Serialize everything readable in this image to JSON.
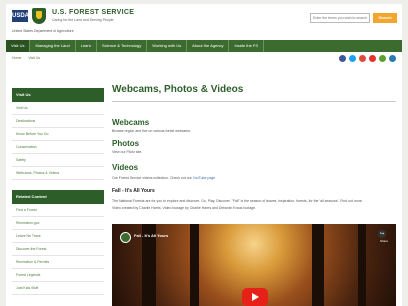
{
  "header": {
    "usda_badge": "USDA",
    "agency": "U.S. FOREST SERVICE",
    "tagline": "Caring for the Land and Serving People",
    "department": "United States Department of Agriculture",
    "search_placeholder": "Enter the terms you wish to search for.",
    "search_button": "Search"
  },
  "nav": {
    "items": [
      "Visit Us",
      "Managing the Land",
      "Learn",
      "Science & Technology",
      "Working with Us",
      "About the Agency",
      "Inside the FS"
    ]
  },
  "breadcrumb": [
    "Home",
    "Visit Us"
  ],
  "social": {
    "colors": [
      "#3b5998",
      "#1da1f2",
      "#dd4b39",
      "#e5312d",
      "#5aa02c",
      "#2a7ab0"
    ]
  },
  "sidebar": {
    "visit_heading": "Visit Us",
    "visit_items": [
      "Visit Us",
      "Destinations",
      "Know Before You Go",
      "Conservation",
      "Safety",
      "Webcams, Photos & Videos"
    ],
    "related_heading": "Related Content",
    "related_items": [
      "Find a Forest",
      "Recreation.gov",
      "Leave No Trace",
      "Discover the Forest",
      "Recreation & Permits",
      "Forest Legends",
      "Just Kids Stuff"
    ]
  },
  "main": {
    "title": "Webcams, Photos & Videos",
    "webcams_heading": "Webcams",
    "webcams_text": "Browse region and live on various forest webcams.",
    "photos_heading": "Photos",
    "photos_text": "View our Flickr site.",
    "videos_heading": "Videos",
    "videos_text_prefix": "Our Forest Service videos collection. Check out our",
    "videos_link": "YouTube page",
    "section_title": "Fall - It's All Yours",
    "section_desc_1": "The National Forests are for you to explore and discover. Go, Play, Discover. \"Fall\" is the season of leaves, inspiration, forests, for the 'all seasons'. Find out more.",
    "section_desc_2": "Video created by Charlie Harris. Video footage by Charlie Harris and Deborah Kraus footage.",
    "video_title": "Fall - It's All Yours",
    "video_share": "Share"
  }
}
